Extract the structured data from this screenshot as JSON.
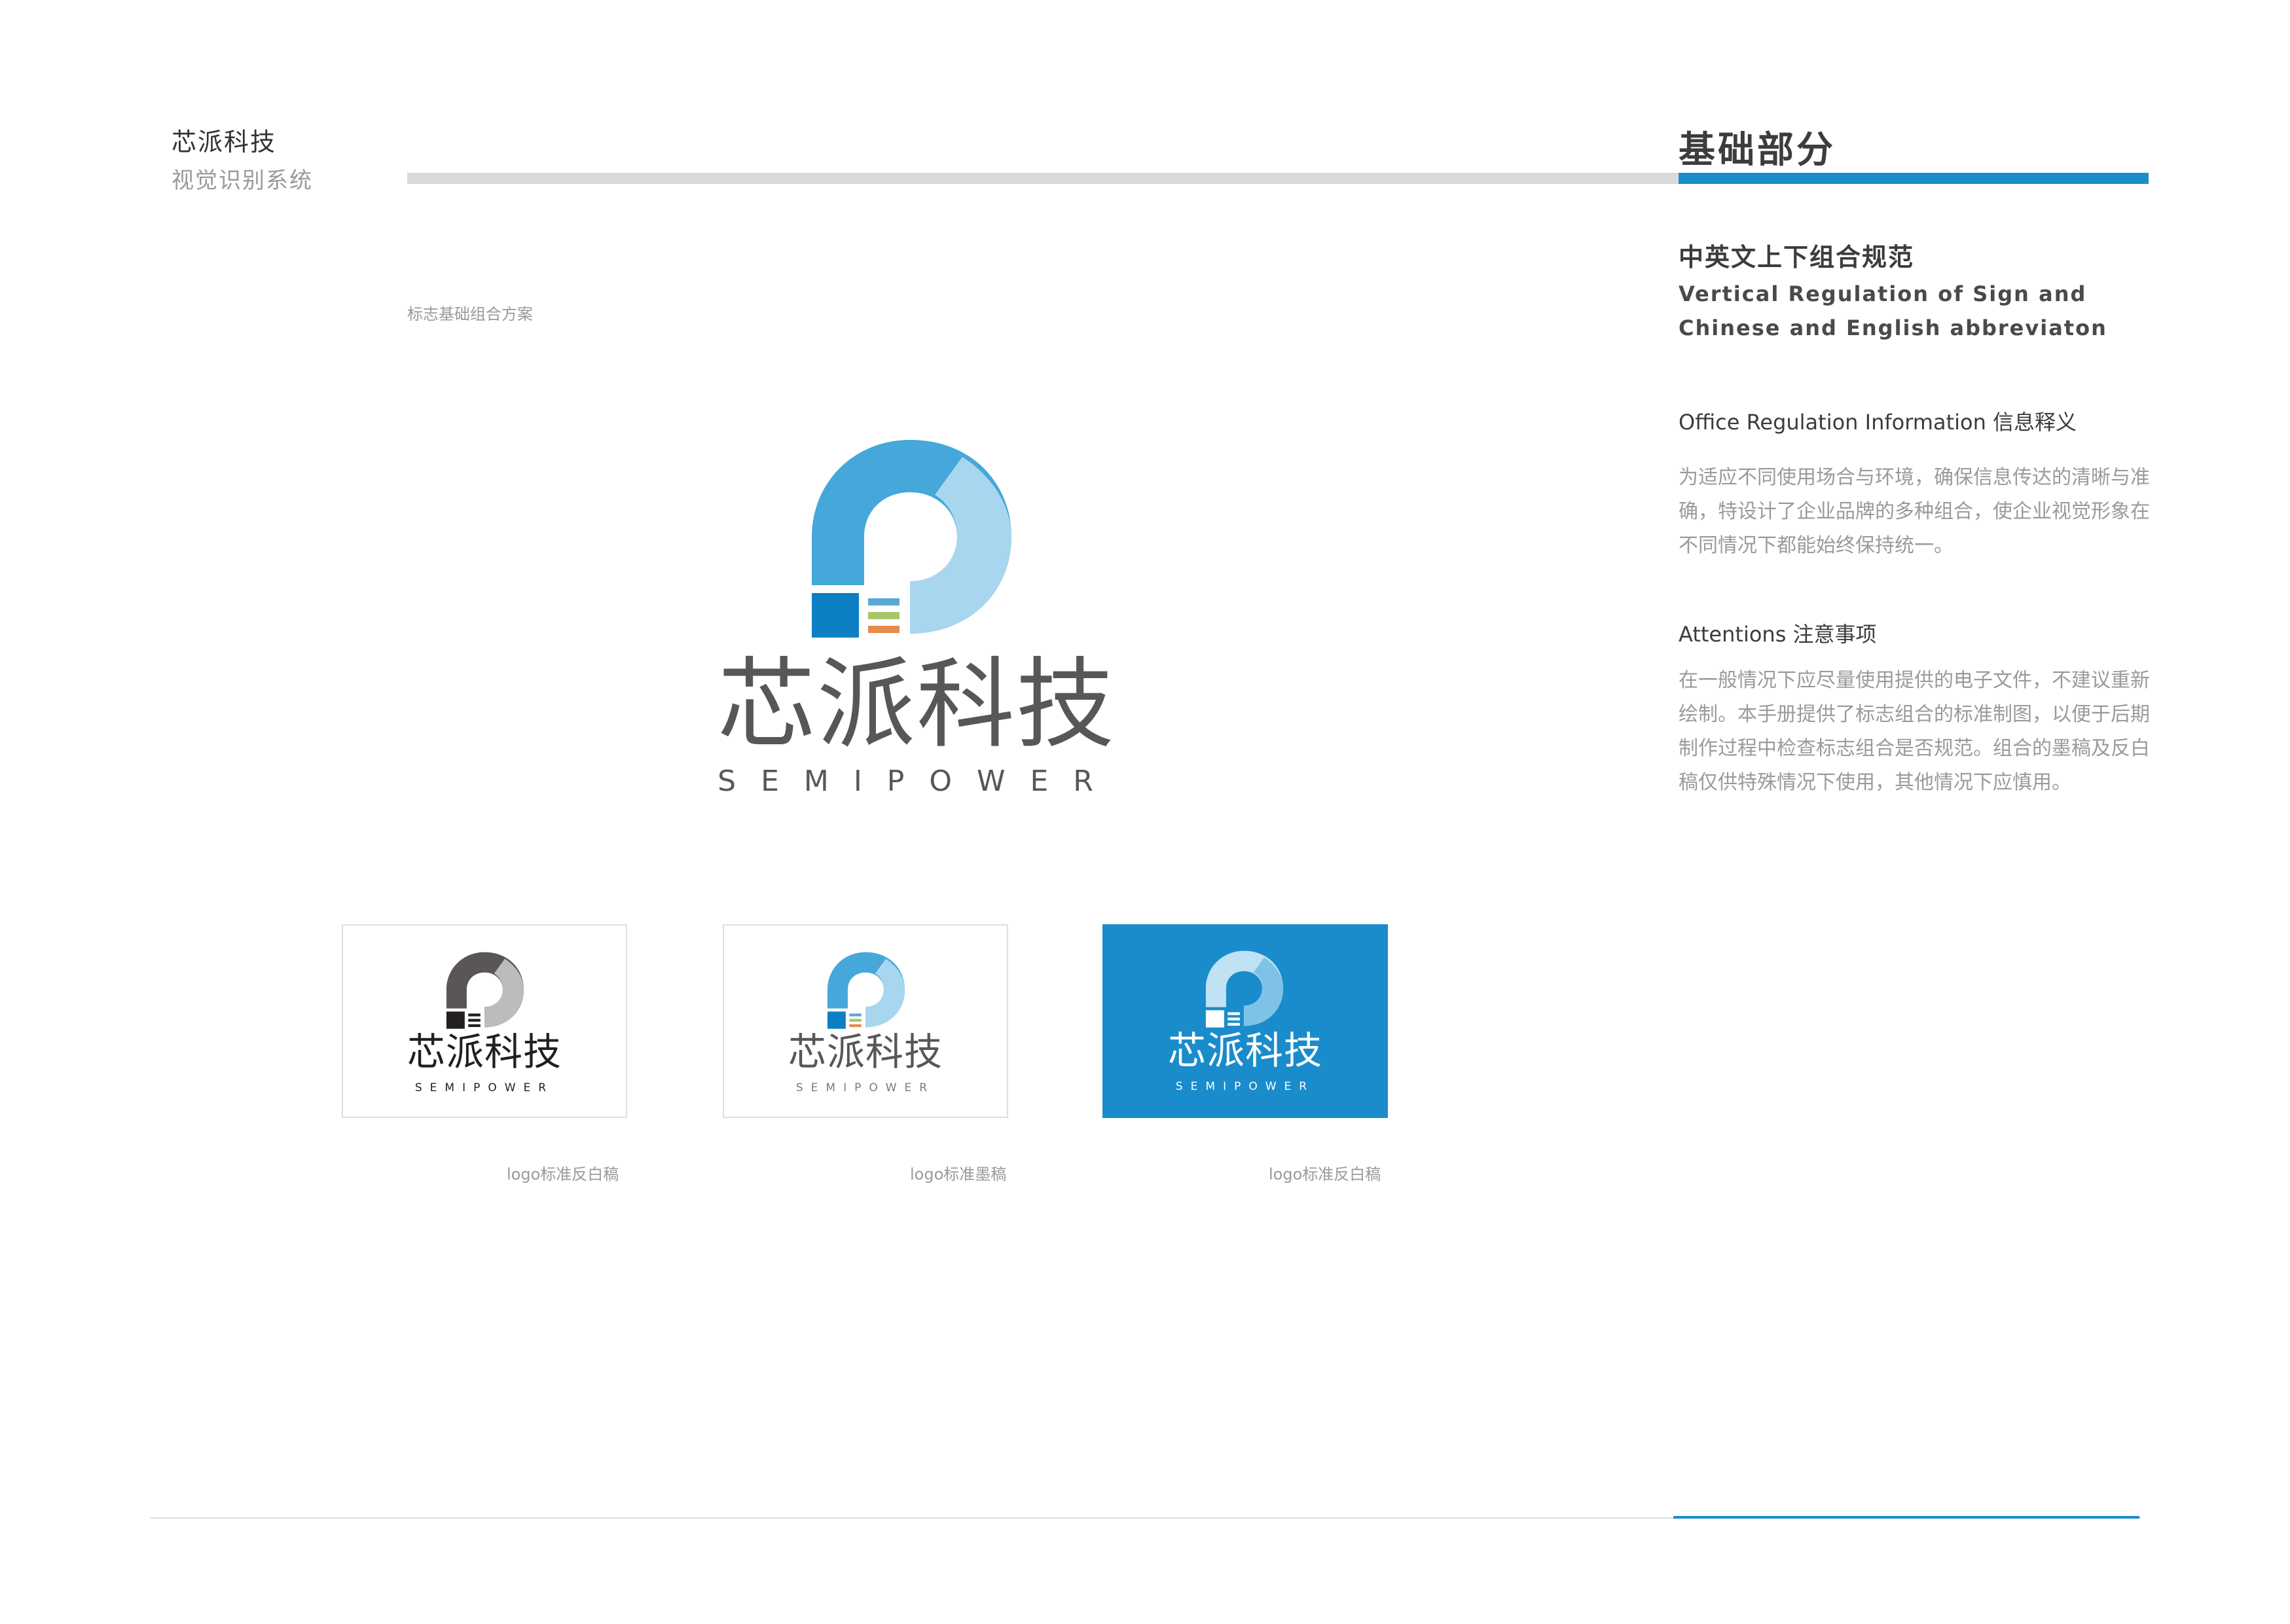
{
  "colors": {
    "accent_blue": "#1a8ccb",
    "logo_dark_blue": "#0d7fc4",
    "logo_mid_blue": "#45a7da",
    "logo_light_blue": "#a9d6ef",
    "text_grey": "#575757",
    "bar_blue": "#5aa8d8",
    "bar_green": "#a9c56a",
    "bar_orange": "#e88a4a"
  },
  "header": {
    "brand_name": "芯派科技",
    "brand_subtitle": "视觉识别系统",
    "section_title": "基础部分"
  },
  "main": {
    "scheme_label": "标志基础组合方案",
    "logo": {
      "icon": "semipower-p-icon",
      "name_cn": "芯派科技",
      "name_en": "SEMIPOWER"
    },
    "variants": [
      {
        "name_cn": "芯派科技",
        "name_en": "SEMIPOWER",
        "caption": "logo标准反白稿"
      },
      {
        "name_cn": "芯派科技",
        "name_en": "SEMIPOWER",
        "caption": "logo标准墨稿"
      },
      {
        "name_cn": "芯派科技",
        "name_en": "SEMIPOWER",
        "caption": "logo标准反白稿"
      }
    ]
  },
  "sidebar": {
    "title": "中英文上下组合规范",
    "title_en_line1": "Vertical Regulation of Sign and",
    "title_en_line2": "Chinese and English abbreviaton",
    "office_heading": "Office Regulation Information 信息释义",
    "office_text": "为适应不同使用场合与环境，确保信息传达的清晰与准确，特设计了企业品牌的多种组合，使企业视觉形象在不同情况下都能始终保持统一。",
    "attention_heading": "Attentions 注意事项",
    "attention_text": "在一般情况下应尽量使用提供的电子文件，不建议重新绘制。本手册提供了标志组合的标准制图，以便于后期制作过程中检查标志组合是否规范。组合的墨稿及反白稿仅供特殊情况下使用，其他情况下应慎用。"
  }
}
